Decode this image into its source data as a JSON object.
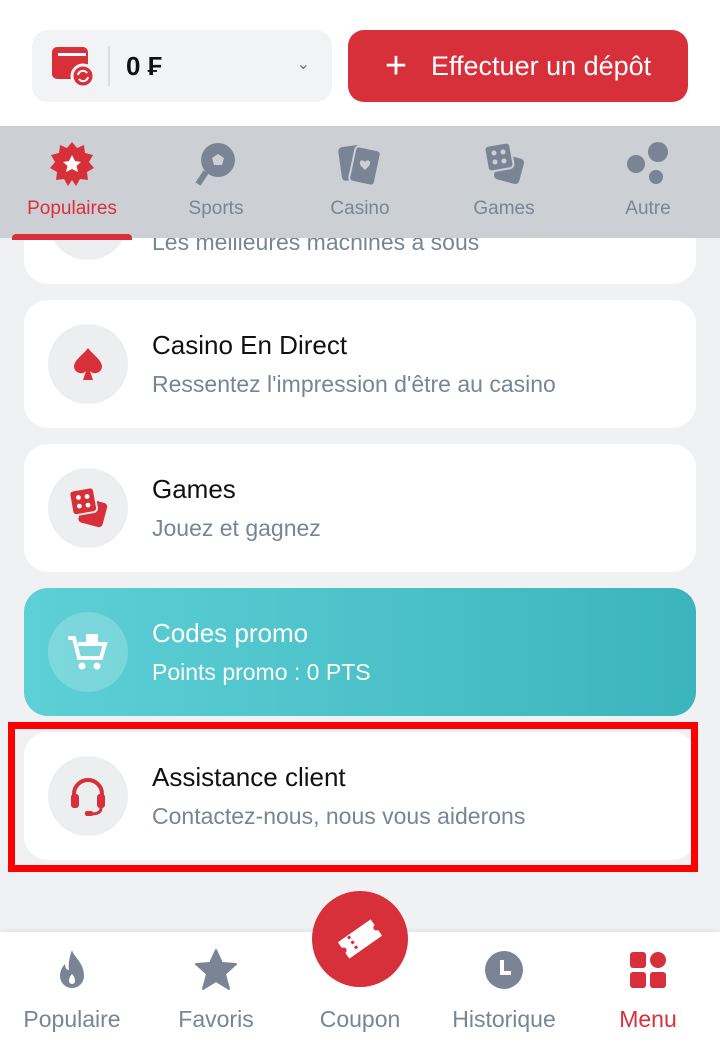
{
  "header": {
    "balance": "0 ₣",
    "deposit_label": "Effectuer un dépôt"
  },
  "categories": [
    {
      "label": "Populaires",
      "icon": "star-badge-icon",
      "active": true
    },
    {
      "label": "Sports",
      "icon": "football-icon"
    },
    {
      "label": "Casino",
      "icon": "cards-icon"
    },
    {
      "label": "Games",
      "icon": "dice-icon"
    },
    {
      "label": "Autre",
      "icon": "dots-icon"
    }
  ],
  "cards": [
    {
      "title": "",
      "subtitle": "Les meilleures machines à sous"
    },
    {
      "title": "Casino En Direct",
      "subtitle": "Ressentez l'impression d'être au casino",
      "icon": "spade-icon"
    },
    {
      "title": "Games",
      "subtitle": "Jouez et gagnez",
      "icon": "dice-icon"
    },
    {
      "title": "Codes promo",
      "subtitle": "Points promo : 0 PTS",
      "icon": "cart-icon"
    },
    {
      "title": "Assistance client",
      "subtitle": "Contactez-nous, nous vous aiderons",
      "icon": "headset-icon"
    }
  ],
  "nav": [
    {
      "label": "Populaire"
    },
    {
      "label": "Favoris"
    },
    {
      "label": "Coupon"
    },
    {
      "label": "Historique"
    },
    {
      "label": "Menu",
      "active": true
    }
  ],
  "colors": {
    "accent": "#d8303a",
    "muted": "#7a8494",
    "promo": "#3cb4bd"
  }
}
